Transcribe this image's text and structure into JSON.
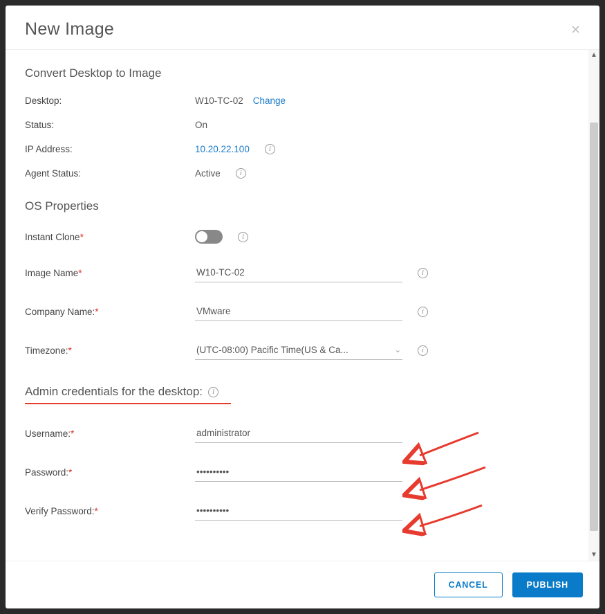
{
  "dialog": {
    "title": "New Image",
    "close_icon": "×"
  },
  "sections": {
    "convert_heading": "Convert Desktop to Image",
    "os_heading": "OS Properties",
    "admin_heading": "Admin credentials for the desktop:"
  },
  "desktop_info": {
    "desktop_label": "Desktop:",
    "desktop_value": "W10-TC-02",
    "change_link": "Change",
    "status_label": "Status:",
    "status_value": "On",
    "ip_label": "IP Address:",
    "ip_value": "10.20.22.100",
    "agent_label": "Agent Status:",
    "agent_value": "Active"
  },
  "os_props": {
    "instant_clone_label": "Instant Clone",
    "instant_clone_on": false,
    "image_name_label": "Image Name",
    "image_name_value": "W10-TC-02",
    "company_label": "Company Name:",
    "company_value": "VMware",
    "timezone_label": "Timezone:",
    "timezone_value": "(UTC-08:00) Pacific Time(US & Ca..."
  },
  "admin": {
    "username_label": "Username:",
    "username_value": "administrator",
    "password_label": "Password:",
    "password_value": "••••••••••",
    "verify_label": "Verify Password:",
    "verify_value": "••••••••••"
  },
  "footer": {
    "cancel": "CANCEL",
    "publish": "PUBLISH"
  },
  "icons": {
    "info": "i",
    "chevron_down": "⌄"
  }
}
